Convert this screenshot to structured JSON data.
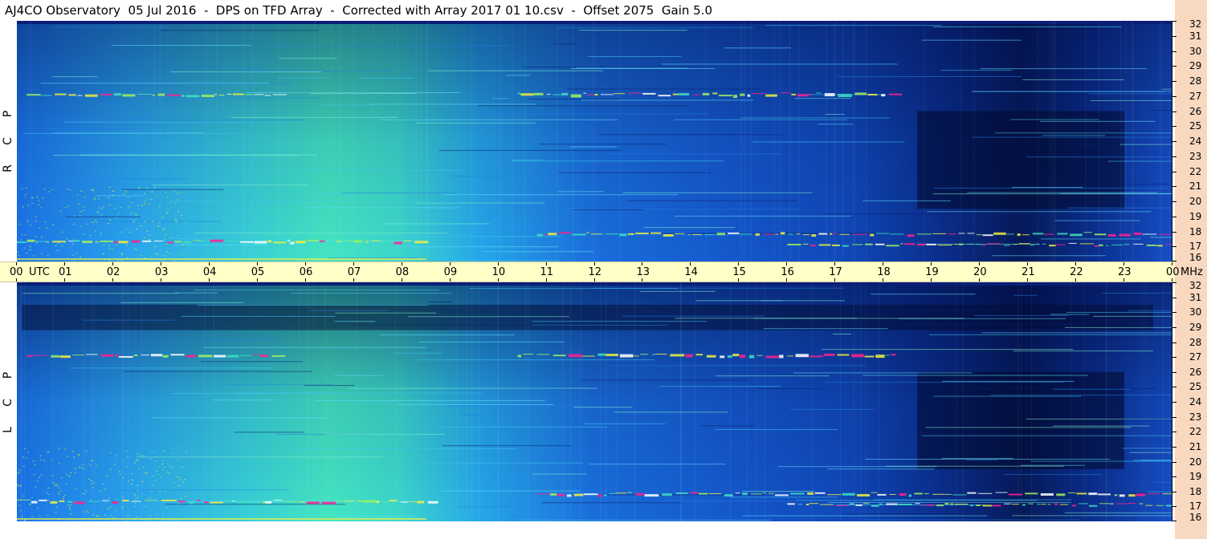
{
  "header": {
    "title": "AJ4CO Observatory  05 Jul 2016  -  DPS on TFD Array  -  Corrected with Array 2017 01 10.csv  -  Offset 2075  Gain 5.0"
  },
  "panels": [
    {
      "id": "rcp",
      "letters": [
        "R",
        "C",
        "P"
      ]
    },
    {
      "id": "lcp",
      "letters": [
        "L",
        "C",
        "P"
      ]
    }
  ],
  "chart_data": {
    "type": "heatmap",
    "title": "AJ4CO Observatory  05 Jul 2016  -  DPS on TFD Array  -  Corrected with Array 2017 01 10.csv  -  Offset 2075  Gain 5.0",
    "x_axis": {
      "unit_label": "UTC",
      "range": [
        0,
        24
      ],
      "tick_labels": [
        "00",
        "01",
        "02",
        "03",
        "04",
        "05",
        "06",
        "07",
        "08",
        "09",
        "10",
        "11",
        "12",
        "13",
        "14",
        "15",
        "16",
        "17",
        "18",
        "19",
        "20",
        "21",
        "22",
        "23",
        "00"
      ]
    },
    "y_axis": {
      "unit_label": "MHz",
      "range": [
        16,
        32
      ],
      "tick_labels": [
        "16",
        "17",
        "18",
        "19",
        "20",
        "21",
        "22",
        "23",
        "24",
        "25",
        "26",
        "27",
        "28",
        "29",
        "30",
        "31",
        "32"
      ]
    },
    "series": [
      {
        "name": "RCP",
        "values": "spectrogram intensity"
      },
      {
        "name": "LCP",
        "values": "spectrogram intensity"
      }
    ],
    "colormap": [
      "#000824",
      "#0a2a8a",
      "#1060e0",
      "#20a0f0",
      "#40e0c0",
      "#a0f060",
      "#f0f040",
      "#ff2090",
      "#ffffff"
    ],
    "background": {
      "time_strip": "#ffffc8",
      "freq_bar": "#f8d8bf"
    }
  }
}
